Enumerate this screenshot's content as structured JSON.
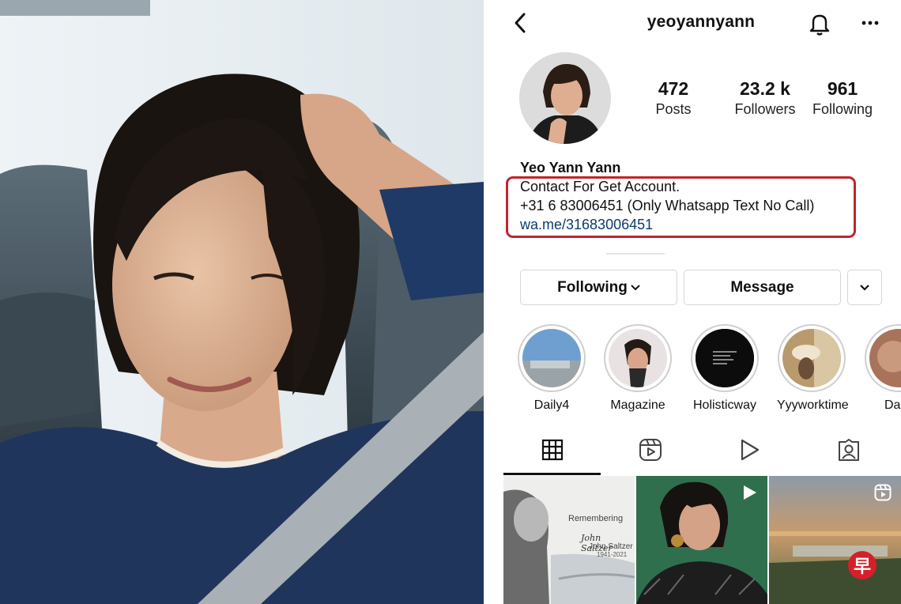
{
  "header": {
    "username": "yeoyannyann",
    "icons": [
      "back-arrow-icon",
      "bell-icon",
      "more-dots-icon"
    ]
  },
  "stats": {
    "posts": {
      "value": "472",
      "label": "Posts"
    },
    "followers": {
      "value": "23.2 k",
      "label": "Followers"
    },
    "following": {
      "value": "961",
      "label": "Following"
    }
  },
  "bio": {
    "name": "Yeo Yann Yann",
    "line1": "Contact For Get Account.",
    "line2": "+31 6 83006451 (Only Whatsapp Text No Call)",
    "link": "wa.me/31683006451",
    "highlight_color": "#c0242f"
  },
  "actions": {
    "following_label": "Following",
    "message_label": "Message"
  },
  "highlights": [
    {
      "label": "Daily4"
    },
    {
      "label": "Magazine"
    },
    {
      "label": "Holisticway"
    },
    {
      "label": "Yyyworktime"
    },
    {
      "label": "Dai"
    }
  ],
  "tabs": [
    "grid-icon",
    "reels-icon",
    "video-play-icon",
    "tagged-icon"
  ],
  "posts": [
    {
      "caption_1": "Remembering",
      "caption_2": "John Saltzer",
      "caption_3": "John Saltzer",
      "caption_4": "1941-2021"
    },
    {
      "type": "video"
    },
    {
      "type": "reel"
    }
  ],
  "watermark": {
    "text": "早",
    "color": "#d5202a"
  }
}
